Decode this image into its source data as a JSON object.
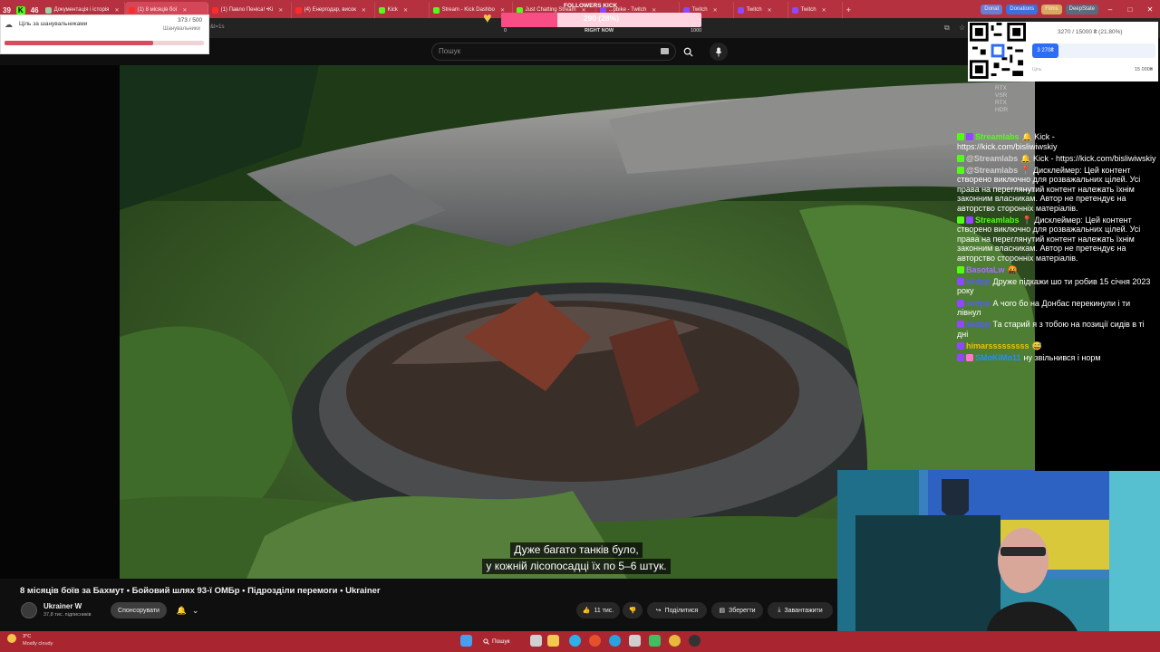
{
  "colors": {
    "tabbar": "#b5313f",
    "taskbar": "#a9252f",
    "followers_fill": "#f94d85",
    "goal_fill": "#d84a5c",
    "donation_blue": "#2d6cf4"
  },
  "tabs": [
    {
      "label": "39",
      "icon": "counter-badge",
      "fav": "#e8e8e8"
    },
    {
      "label": "K",
      "icon": "kick-icon",
      "fav": "#53fc18"
    },
    {
      "label": "46",
      "icon": "counter-badge",
      "fav": "#e8e8e8"
    },
    {
      "label": "Документація і історія",
      "fav": "#9ed0a6"
    },
    {
      "label": "(1) 8 місяців бої",
      "fav": "#ff2b2b",
      "active": true
    },
    {
      "label": "(1) Павло Пеніса! •Ki",
      "fav": "#ff2b2b"
    },
    {
      "label": "(4) Енергодар, висок",
      "fav": "#ff2b2b"
    },
    {
      "label": "Kick",
      "fav": "#53fc18"
    },
    {
      "label": "Stream - Kick Dashbo",
      "fav": "#53fc18"
    },
    {
      "label": "Just Chatting Stream",
      "fav": "#53fc18"
    },
    {
      "label": "...pbike - Twitch",
      "fav": "#9146ff"
    },
    {
      "label": "Twitch",
      "fav": "#9146ff"
    },
    {
      "label": "Twitch",
      "fav": "#9146ff"
    },
    {
      "label": "Twitch",
      "fav": "#9146ff"
    }
  ],
  "chips": [
    {
      "label": "Donat",
      "bg": "#6b7cd1"
    },
    {
      "label": "Donations",
      "bg": "#3b6ee0"
    },
    {
      "label": "Films",
      "bg": "#d9a85c"
    },
    {
      "label": "DeepState",
      "bg": "#5a6b7d"
    }
  ],
  "address": {
    "url": "&t=1s"
  },
  "search": {
    "placeholder": "Пошук"
  },
  "goal": {
    "title": "Ціль за шанувальниками",
    "count": "373 / 500",
    "subtitle": "Шанувальники",
    "fraction": 0.746
  },
  "followers": {
    "title": "FOLLOWERS KICK",
    "value": "290 (28%)",
    "fraction": 0.28,
    "min": "0",
    "mid": "RIGHT NOW",
    "max": "1000"
  },
  "donation": {
    "progress": "3270 / 15000 ₴ (21.80%)",
    "amount": "3 270₴",
    "fraction": 0.218,
    "goal_label": "Ціль",
    "goal_value": "15 000₴"
  },
  "subtitles": [
    "Дуже багато танків було,",
    "у кожній лісопосадці їх по 5–6 штук."
  ],
  "video": {
    "title": "8 місяців боїв за Бахмут • Бойовий шлях 93-ї ОМБр • Підрозділи перемоги • Ukrainer",
    "channel": "Ukrainer W",
    "subscribers": "37,8 тис. підписників",
    "sponsor": "Спонсорувати",
    "likes": "11 тис.",
    "share": "Поділитися",
    "save": "Зберегти",
    "download": "Завантажити"
  },
  "chat": [
    {
      "user": "Streamlabs",
      "color": "#53fc18",
      "badges": [
        "#53fc18",
        "#9146ff"
      ],
      "text": "🔔 Kick - https://kick.com/bisliwiwskiy"
    },
    {
      "user": "@Streamlabs",
      "color": "#cfcfcf",
      "badges": [
        "#53fc18"
      ],
      "text": "🔔 Kick - https://kick.com/bisliwiwskiy"
    },
    {
      "user": "@Streamlabs",
      "color": "#cfcfcf",
      "badges": [
        "#53fc18"
      ],
      "text": "📍 Дисклеймер: Цей контент створено виключно для розважальних цілей. Усі права на переглянутий контент належать їхнім законним власникам. Автор не претендує на авторство сторонніх матеріалів."
    },
    {
      "user": "Streamlabs",
      "color": "#53fc18",
      "badges": [
        "#53fc18",
        "#9146ff"
      ],
      "text": "📍 Дисклеймер: Цей контент створено виключно для розважальних цілей. Усі права на переглянутий контент належать їхнім законним власникам. Автор не претендує на авторство сторонніх матеріалів."
    },
    {
      "user": "BasotaLw",
      "color": "#a970ff",
      "badges": [
        "#53fc18"
      ],
      "text": "🤬"
    },
    {
      "user": "skdpp",
      "color": "#5a5aff",
      "badges": [
        "#9146ff"
      ],
      "text": "Друже підкажи шо ти робив 15 січня 2023 року"
    },
    {
      "user": "skdpp",
      "color": "#5a5aff",
      "badges": [
        "#9146ff"
      ],
      "text": "А чого бо на Донбас перекинули і ти лівнул"
    },
    {
      "user": "skdpp",
      "color": "#5a5aff",
      "badges": [
        "#9146ff"
      ],
      "text": "Та старий я з тобою на позиції сидів в ті дні"
    },
    {
      "user": "himarsssssssss",
      "color": "#f0c000",
      "badges": [
        "#9146ff"
      ],
      "text": "😅"
    },
    {
      "user": "SMoKiMo11",
      "color": "#1e90ff",
      "badges": [
        "#9146ff",
        "#ff77c8"
      ],
      "text": "ну звільнився і норм"
    }
  ],
  "taskbar": {
    "temp": "3°C",
    "weather": "Mostly cloudy",
    "search": "Пошук"
  }
}
